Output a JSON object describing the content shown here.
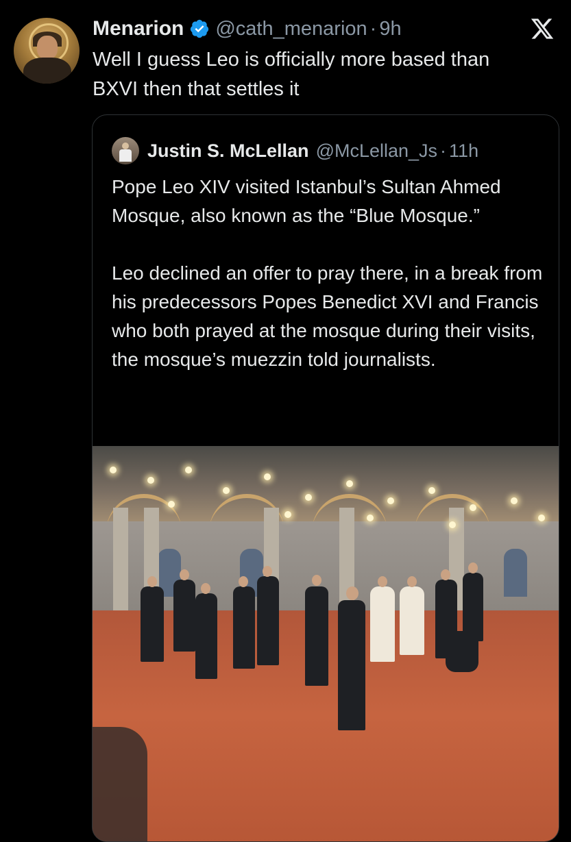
{
  "tweet": {
    "author_name": "Menarion",
    "author_handle": "@cath_menarion",
    "time": "9h",
    "verified": true,
    "text_line1": "Well I guess Leo is officially more based than",
    "text_line2": "BXVI then that settles it",
    "avatar_icon": "saint-portrait-avatar",
    "logo_icon": "x-logo-icon"
  },
  "quote": {
    "author_name": "Justin S. McLellan",
    "author_handle": "@McLellan_Js",
    "time": "11h",
    "paragraph1": "Pope Leo XIV visited Istanbul’s Sultan Ahmed Mosque, also known as the “Blue Mosque.”",
    "paragraph2": "Leo declined an offer to pray there, in a break from his predecessors Popes Benedict XVI and Francis who both prayed at the mosque during their visits, the mosque’s muezzin told journalists.",
    "media_icon": "mosque-visit-photo"
  },
  "colors": {
    "background": "#000000",
    "text": "#e7e9ea",
    "secondary": "#8b98a5",
    "verified_blue": "#1d9bf0",
    "border": "#2f3336"
  }
}
